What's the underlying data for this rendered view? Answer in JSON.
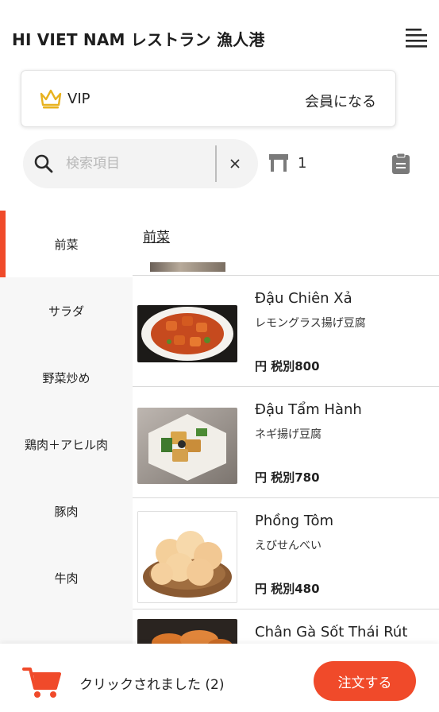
{
  "header": {
    "title": "HI VIET NAM レストラン 漁人港",
    "menu_icon": "hamburger-menu-icon"
  },
  "vip": {
    "label": "VIP",
    "join_label": "会員になる",
    "icon": "crown-icon",
    "accent_color": "#e8b21e"
  },
  "search": {
    "placeholder": "検索項目",
    "value": "",
    "icon": "search-icon",
    "clear_icon": "close-icon"
  },
  "table": {
    "icon": "table-icon",
    "number": "1"
  },
  "order_list_icon": "clipboard-icon",
  "categories": [
    {
      "label": "前菜",
      "active": true
    },
    {
      "label": "サラダ",
      "active": false
    },
    {
      "label": "野菜炒め",
      "active": false
    },
    {
      "label": "鶏肉＋アヒル肉",
      "active": false
    },
    {
      "label": "豚肉",
      "active": false
    },
    {
      "label": "牛肉",
      "active": false
    }
  ],
  "section_title": "前菜",
  "menu_items": [
    {
      "name": "Đậu Chiên Xả",
      "subtitle": "レモングラス揚げ豆腐",
      "price": "円 税別800"
    },
    {
      "name": "Đậu Tẩm Hành",
      "subtitle": "ネギ揚げ豆腐",
      "price": "円 税別780"
    },
    {
      "name": "Phồng Tôm",
      "subtitle": "えびせんべい",
      "price": "円 税別480"
    },
    {
      "name": "Chân Gà Sốt Thái Rút",
      "subtitle": "",
      "price": ""
    }
  ],
  "footer": {
    "cart_icon": "shopping-cart-icon",
    "clicked_text": "クリックされました (2)",
    "order_label": "注文する"
  },
  "colors": {
    "accent": "#f04a2a",
    "sidebar_bg": "#f7f7f7",
    "search_bg": "#f3f3f3"
  }
}
